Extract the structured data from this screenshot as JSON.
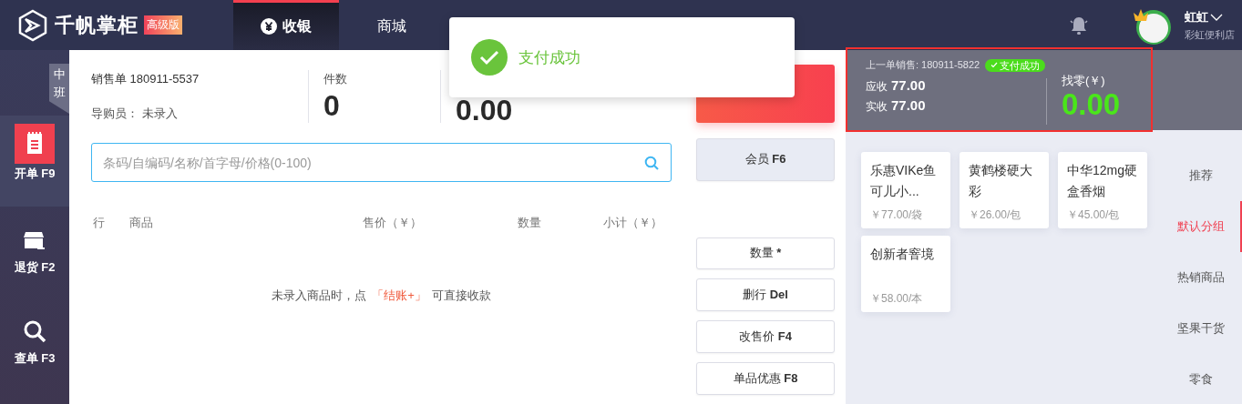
{
  "header": {
    "logo": "千帆掌柜",
    "edition": "高级版",
    "tabs": [
      {
        "label": "收银",
        "selected": true,
        "kind": "yen"
      },
      {
        "label": "商城",
        "selected": false,
        "kind": "plain"
      }
    ],
    "user": {
      "name": "虹虹",
      "store": "彩虹便利店"
    }
  },
  "shift": "中班",
  "sidebar": [
    {
      "label": "开单 F9",
      "selected": true,
      "kind": "receipt"
    },
    {
      "label": "退货 F2",
      "selected": false,
      "kind": "box"
    },
    {
      "label": "查单 F3",
      "selected": false,
      "kind": "search"
    }
  ],
  "order": {
    "number": "销售单 180911-5537",
    "guide_label": "导购员：",
    "guide_value": "未录入",
    "count_label": "件数",
    "count": "0",
    "total": "0.00"
  },
  "search": {
    "placeholder": "条码/自编码/名称/首字母/价格(0-100)"
  },
  "table": {
    "columns": [
      "行",
      "商品",
      "售价（￥）",
      "数量",
      "小计（￥）"
    ],
    "empty_before": "未录入商品时，点",
    "empty_link": "「结账+」",
    "empty_after": "可直接收款"
  },
  "member_button": {
    "label": "会员",
    "key": "F6"
  },
  "edit_buttons": [
    {
      "label": "数量",
      "key": "*"
    },
    {
      "label": "删行",
      "key": "Del"
    },
    {
      "label": "改售价",
      "key": "F4"
    },
    {
      "label": "单品优惠",
      "key": "F8"
    }
  ],
  "last_sale": {
    "label": "上一单销售: 180911-5822",
    "status": "支付成功",
    "due_label": "应收",
    "due": "77.00",
    "paid_label": "实收",
    "paid": "77.00",
    "change_label": "找零(￥)",
    "change": "0.00"
  },
  "products": [
    {
      "name": "乐惠VIKe鱼可儿小...",
      "price": "￥77.00/袋"
    },
    {
      "name": "黄鹤楼硬大彩",
      "price": "￥26.00/包"
    },
    {
      "name": "中华12mg硬盒香烟",
      "price": "￥45.00/包"
    },
    {
      "name": "创新者窨境",
      "price": "￥58.00/本"
    }
  ],
  "categories": [
    {
      "label": "推荐",
      "selected": false
    },
    {
      "label": "默认分组",
      "selected": true
    },
    {
      "label": "热销商品",
      "selected": false
    },
    {
      "label": "坚果干货",
      "selected": false
    },
    {
      "label": "零食",
      "selected": false
    }
  ],
  "toast": {
    "message": "支付成功"
  }
}
